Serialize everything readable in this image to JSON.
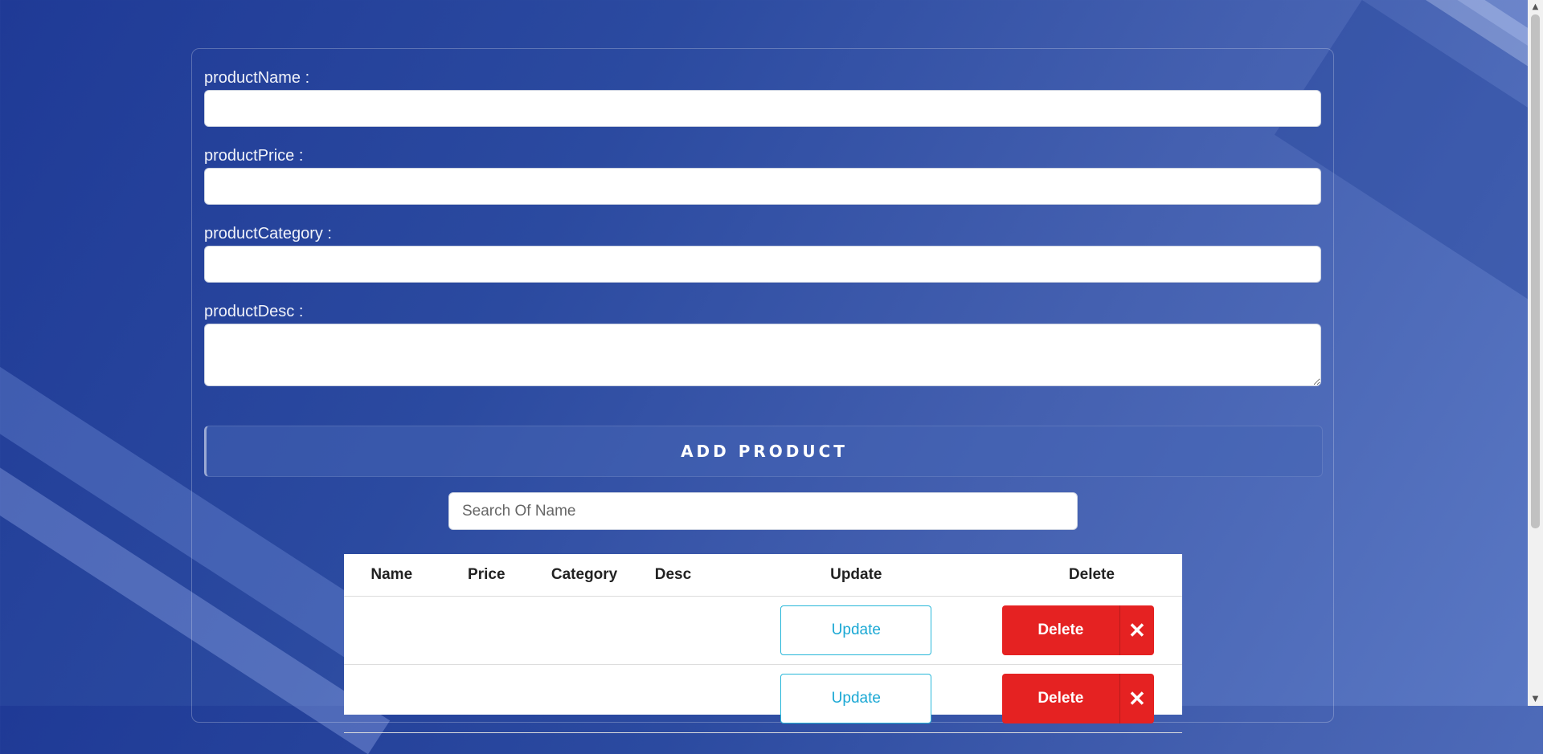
{
  "form": {
    "name_label": "productName :",
    "price_label": "productPrice :",
    "category_label": "productCategory :",
    "desc_label": "productDesc :",
    "name_value": "",
    "price_value": "",
    "category_value": "",
    "desc_value": "",
    "add_button": "ADD PRODUCT"
  },
  "search": {
    "placeholder": "Search Of Name"
  },
  "table": {
    "headers": [
      "Name",
      "Price",
      "Category",
      "Desc",
      "Update",
      "Delete"
    ],
    "rows": [
      {
        "name": "",
        "price": "",
        "category": "",
        "desc": "",
        "update": "Update",
        "delete": "Delete"
      },
      {
        "name": "",
        "price": "",
        "category": "",
        "desc": "",
        "update": "Update",
        "delete": "Delete"
      }
    ]
  },
  "icons": {
    "delete_icon": "close-icon"
  }
}
